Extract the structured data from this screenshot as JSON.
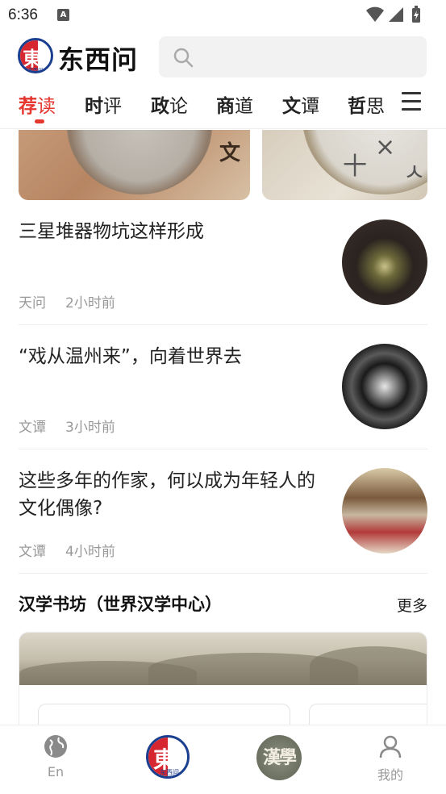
{
  "status_bar": {
    "time": "6:36",
    "notification_icon": "A"
  },
  "header": {
    "logo_text": "东西问",
    "logo_glyph": "東",
    "logo_mini": "东西问",
    "search_placeholder": ""
  },
  "tabs": [
    {
      "strong": "荐",
      "rest": "读",
      "active": true
    },
    {
      "strong": "时",
      "rest": "评",
      "active": false
    },
    {
      "strong": "政",
      "rest": "论",
      "active": false
    },
    {
      "strong": "商",
      "rest": "道",
      "active": false
    },
    {
      "strong": "文",
      "rest": "谭",
      "active": false
    },
    {
      "strong": "哲",
      "rest": "思",
      "active": false
    }
  ],
  "banner": {
    "left_char": "文"
  },
  "news": [
    {
      "title": "三星堆器物坑这样形成",
      "source": "天问",
      "time": "2小时前"
    },
    {
      "title": "“戏从温州来”，向着世界去",
      "source": "文谭",
      "time": "3小时前"
    },
    {
      "title": "这些多年的作家，何以成为年轻人的文化偶像?",
      "source": "文谭",
      "time": "4小时前"
    }
  ],
  "section": {
    "title": "汉学书坊（世界汉学中心）",
    "more": "更多"
  },
  "bottom_nav": {
    "en_label": "En",
    "center_glyph": "東",
    "center_mini": "东西问",
    "han_glyph": "漢學",
    "mine_label": "我的"
  },
  "colors": {
    "accent": "#e5362f",
    "brand_blue": "#1b3f8f",
    "brand_red": "#d6262f"
  }
}
